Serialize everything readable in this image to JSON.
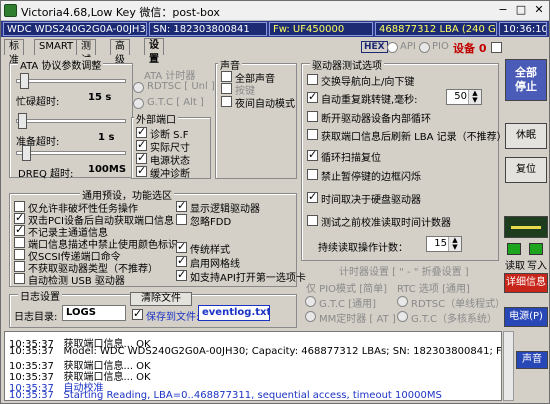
{
  "title": {
    "text": "Victoria4.68,Low Key 微信：post-box",
    "minimize": "−",
    "maximize": "□",
    "close": "✕"
  },
  "infobar": {
    "model": "WDC WDS240G2G0A-00JH30",
    "sn": "SN: 182303800841",
    "fw": "Fw: UF450000",
    "lba": "468877312 LBA (240 Gb)",
    "time": "10:36:10"
  },
  "tabs": [
    "标准",
    "SMART",
    "测试",
    "高级",
    "设置"
  ],
  "hex": "HEX",
  "api_label": "API",
  "pio_label": "PIO",
  "device_label": "设备 0",
  "cb_top_label": "",
  "ata": {
    "title": "ATA 协议参数调整",
    "busy_label": "忙碌超时:",
    "busy_value": "15 s",
    "ready_label": "准备超时:",
    "ready_value": "1 s",
    "dreq_label": "DREQ 超时:",
    "dreq_value": "100MS",
    "timer_title": "ATA 计时器",
    "timer_rdtsc": "RDTSC [ Unl ]",
    "timer_gtc": "G.T.C [ Alt ]"
  },
  "ext_port": {
    "title": "外部端口",
    "items": [
      "诊断 S.F",
      "实际尺寸",
      "电源状态",
      "缓冲诊断"
    ]
  },
  "sound": {
    "title": "声音",
    "items": [
      "全部声音",
      "按键",
      "夜间自动模式"
    ]
  },
  "drive_test": {
    "title": "驱动器测试选项",
    "items": [
      "交换导航向上/向下键",
      "自动重复跳转键,毫秒:",
      "断开驱动器设备内部循环",
      "获取端口信息后刷新 LBA 记录（不推荐）",
      "循环扫描复位",
      "禁止暂停键的边框闪烁",
      "时间取决于硬盘驱动器",
      "测试之前校准读取时间计数器"
    ],
    "repeat_value": "50",
    "cycle_label": "持续读取操作计数：",
    "cycle_value": "15"
  },
  "common": {
    "title": "通用预设，功能选区",
    "items_left": [
      "仅允许非破坏性任务操作",
      "双击PCI设备后自动获取端口信息",
      "不记录主通道信息",
      "端口信息描述中禁止使用颜色标识",
      "仅SCSI传递端口命令",
      "不获取驱动器类型（不推荐）",
      "自动检测 USB 驱动器"
    ],
    "items_right": [
      "显示逻辑驱动器",
      "忽略FDD",
      "传统样式",
      "启用网格线",
      "如支持API打开第一选项卡"
    ]
  },
  "log_settings": {
    "title": "日志设置",
    "dir_label": "日志目录:",
    "dir_value": "LOGS",
    "clear_button": "清除文件",
    "save_label": "保存到文件:",
    "file_value": "eventlog.txt"
  },
  "timer_settings": {
    "title": "计时器设置 [ \" - \" 折叠设置 ]",
    "pio_title": "仅 PIO模式 [简单]",
    "rtc_title": "RTC 选项 [通用]",
    "pio_gtc": "G.T.C   [通用]",
    "pio_mm": "MM定时器 [ AT ]",
    "rtc_rdtsc": "RDTSC（单线程式）",
    "rtc_gtc": "G.T.C（多核系统）"
  },
  "right_panel": {
    "stop_all": "全部\n停止",
    "sleep": "休眠",
    "reset": "复位",
    "read_label": "读取",
    "write_label": "写入",
    "details": "详细信息",
    "power": "电源(P)",
    "sound": "声音"
  },
  "log": [
    {
      "time": "10:35:37",
      "text": "获取端口信息... OK",
      "blue": false
    },
    {
      "time": "10:35:37",
      "text": "Model: WDC WDS240G2G0A-00JH30; Capacity: 468877312 LBAs; SN: 182303800841; FW: UF450000",
      "blue": false
    },
    {
      "time": "10:35:37",
      "text": "获取端口信息... OK",
      "blue": false
    },
    {
      "time": "10:35:37",
      "text": "获取端口信息... OK",
      "blue": false
    },
    {
      "time": "10:35:37",
      "text": "自动校准",
      "blue": true
    },
    {
      "time": "10:35:37",
      "text": "Starting Reading, LBA=0..468877311, sequential access, timeout 10000MS",
      "blue": true
    }
  ],
  "colors": {
    "infobar_bg": "#2b3a8f",
    "info_field_bg": "#1c2a74",
    "stop_btn": "#4b5cb8",
    "details_btn": "#c8261a",
    "power_btn": "#2948b8",
    "sound_btn": "#2948b8",
    "device_text": "#c00000"
  }
}
